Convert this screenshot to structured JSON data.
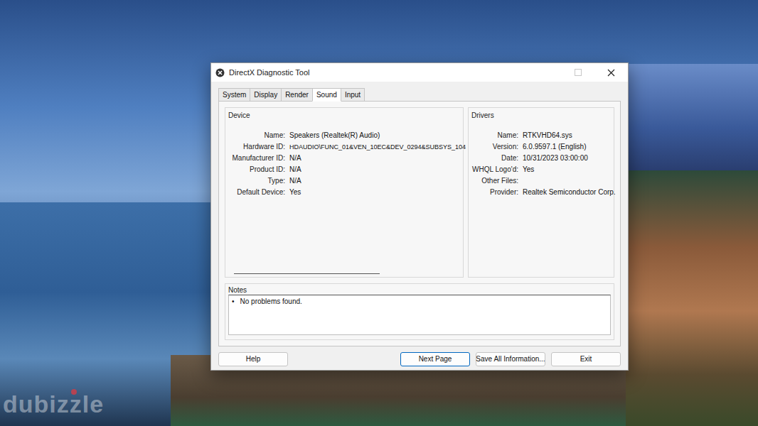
{
  "window": {
    "title": "DirectX Diagnostic Tool"
  },
  "tabs": [
    {
      "label": "System",
      "selected": false
    },
    {
      "label": "Display",
      "selected": false
    },
    {
      "label": "Render",
      "selected": false
    },
    {
      "label": "Sound",
      "selected": true
    },
    {
      "label": "Input",
      "selected": false
    }
  ],
  "device": {
    "title": "Device",
    "fields": [
      {
        "label": "Name:",
        "value": "Speakers (Realtek(R) Audio)"
      },
      {
        "label": "Hardware ID:",
        "value": "HDAUDIO\\FUNC_01&VEN_10EC&DEV_0294&SUBSYS_104"
      },
      {
        "label": "Manufacturer ID:",
        "value": "N/A"
      },
      {
        "label": "Product ID:",
        "value": "N/A"
      },
      {
        "label": "Type:",
        "value": "N/A"
      },
      {
        "label": "Default Device:",
        "value": "Yes"
      }
    ]
  },
  "drivers": {
    "title": "Drivers",
    "fields": [
      {
        "label": "Name:",
        "value": "RTKVHD64.sys"
      },
      {
        "label": "Version:",
        "value": "6.0.9597.1 (English)"
      },
      {
        "label": "Date:",
        "value": "10/31/2023 03:00:00"
      },
      {
        "label": "WHQL Logo'd:",
        "value": "Yes"
      },
      {
        "label": "Other Files:",
        "value": ""
      },
      {
        "label": "Provider:",
        "value": "Realtek Semiconductor Corp."
      }
    ]
  },
  "notes": {
    "title": "Notes",
    "items": [
      {
        "bullet": "•",
        "text": "No problems found."
      }
    ]
  },
  "buttons": [
    "Help",
    "Next Page",
    "Save All Information...",
    "Exit"
  ],
  "watermark": "dubizzle"
}
